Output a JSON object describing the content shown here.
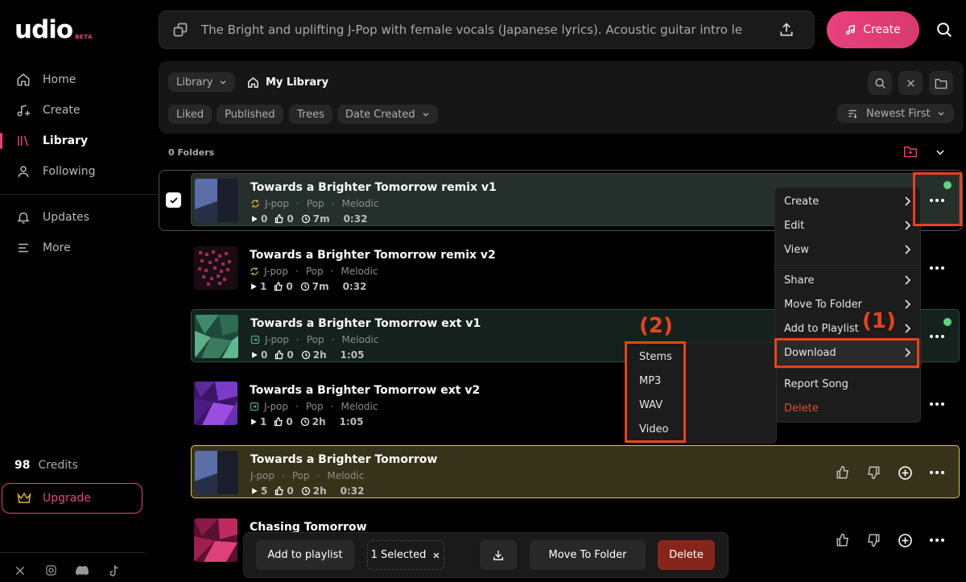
{
  "logo": {
    "text": "udio",
    "badge": "BETA"
  },
  "nav": {
    "home": "Home",
    "create": "Create",
    "library": "Library",
    "following": "Following",
    "updates": "Updates",
    "more": "More"
  },
  "credits": {
    "count": "98",
    "label": "Credits"
  },
  "upgrade_label": "Upgrade",
  "prompt": {
    "text": "The Bright and uplifting J-Pop with female vocals (Japanese lyrics). Acoustic guitar intro le"
  },
  "create_label": "Create",
  "library": {
    "dropdown": "Library",
    "crumb": "My Library",
    "filters": [
      "Liked",
      "Published",
      "Trees",
      "Date Created"
    ],
    "sort": "Newest First",
    "folders": "0 Folders"
  },
  "songs": [
    {
      "title": "Towards a Brighter Tomorrow remix v1",
      "tags": [
        "J-pop",
        "Pop",
        "Melodic"
      ],
      "plays": "0",
      "likes": "0",
      "age": "7m",
      "duration": "0:32"
    },
    {
      "title": "Towards a Brighter Tomorrow remix v2",
      "tags": [
        "J-pop",
        "Pop",
        "Melodic"
      ],
      "plays": "1",
      "likes": "0",
      "age": "7m",
      "duration": "0:32"
    },
    {
      "title": "Towards a Brighter Tomorrow ext v1",
      "tags": [
        "J-pop",
        "Pop",
        "Melodic"
      ],
      "plays": "0",
      "likes": "0",
      "age": "2h",
      "duration": "1:05"
    },
    {
      "title": "Towards a Brighter Tomorrow ext v2",
      "tags": [
        "J-pop",
        "Pop",
        "Melodic"
      ],
      "plays": "1",
      "likes": "0",
      "age": "2h",
      "duration": "1:05"
    },
    {
      "title": "Towards a Brighter Tomorrow",
      "tags": [
        "J-pop",
        "Pop",
        "Melodic"
      ],
      "plays": "5",
      "likes": "0",
      "age": "2h",
      "duration": "0:32"
    },
    {
      "title": "Chasing Tomorrow"
    }
  ],
  "context_menu": {
    "create": "Create",
    "edit": "Edit",
    "view": "View",
    "share": "Share",
    "move_to_folder": "Move To Folder",
    "add_to_playlist": "Add to Playlist",
    "download": "Download",
    "report": "Report Song",
    "delete": "Delete"
  },
  "download_menu": {
    "stems": "Stems",
    "mp3": "MP3",
    "wav": "WAV",
    "video": "Video"
  },
  "callouts": {
    "one": "(1)",
    "two": "(2)"
  },
  "action_bar": {
    "add_playlist": "Add to playlist",
    "selected": "1 Selected",
    "move_folder": "Move To Folder",
    "delete": "Delete"
  },
  "colors": {
    "accent": "#e8417c",
    "highlight": "#e8431c",
    "status": "#5cd87c"
  }
}
